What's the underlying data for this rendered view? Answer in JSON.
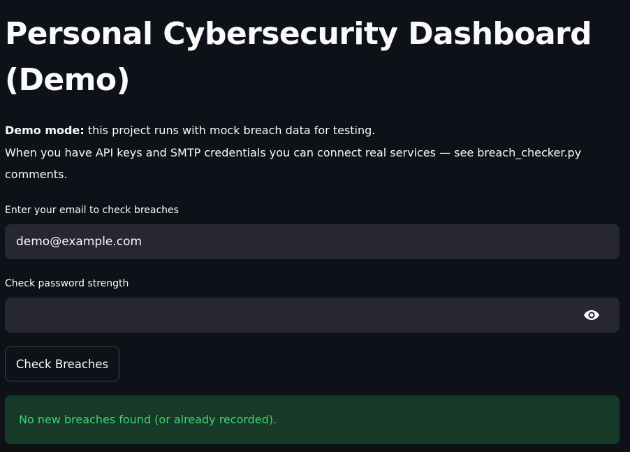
{
  "title": "Personal Cybersecurity Dashboard (Demo)",
  "description": {
    "bold": "Demo mode:",
    "line1": " this project runs with mock breach data for testing.",
    "line2": "When you have API keys and SMTP credentials you can connect real services — see breach_checker.py comments."
  },
  "email_field": {
    "label": "Enter your email to check breaches",
    "value": "demo@example.com"
  },
  "password_field": {
    "label": "Check password strength",
    "value": "",
    "toggle_icon": "eye-icon"
  },
  "check_button": {
    "label": "Check Breaches"
  },
  "alert": {
    "message": "No new breaches found (or already recorded).",
    "type": "success",
    "color": "#3dd56d"
  },
  "colors": {
    "background": "#0e1117",
    "input_background": "#262730",
    "success_background": "#173928",
    "success_text": "#3dd56d"
  }
}
